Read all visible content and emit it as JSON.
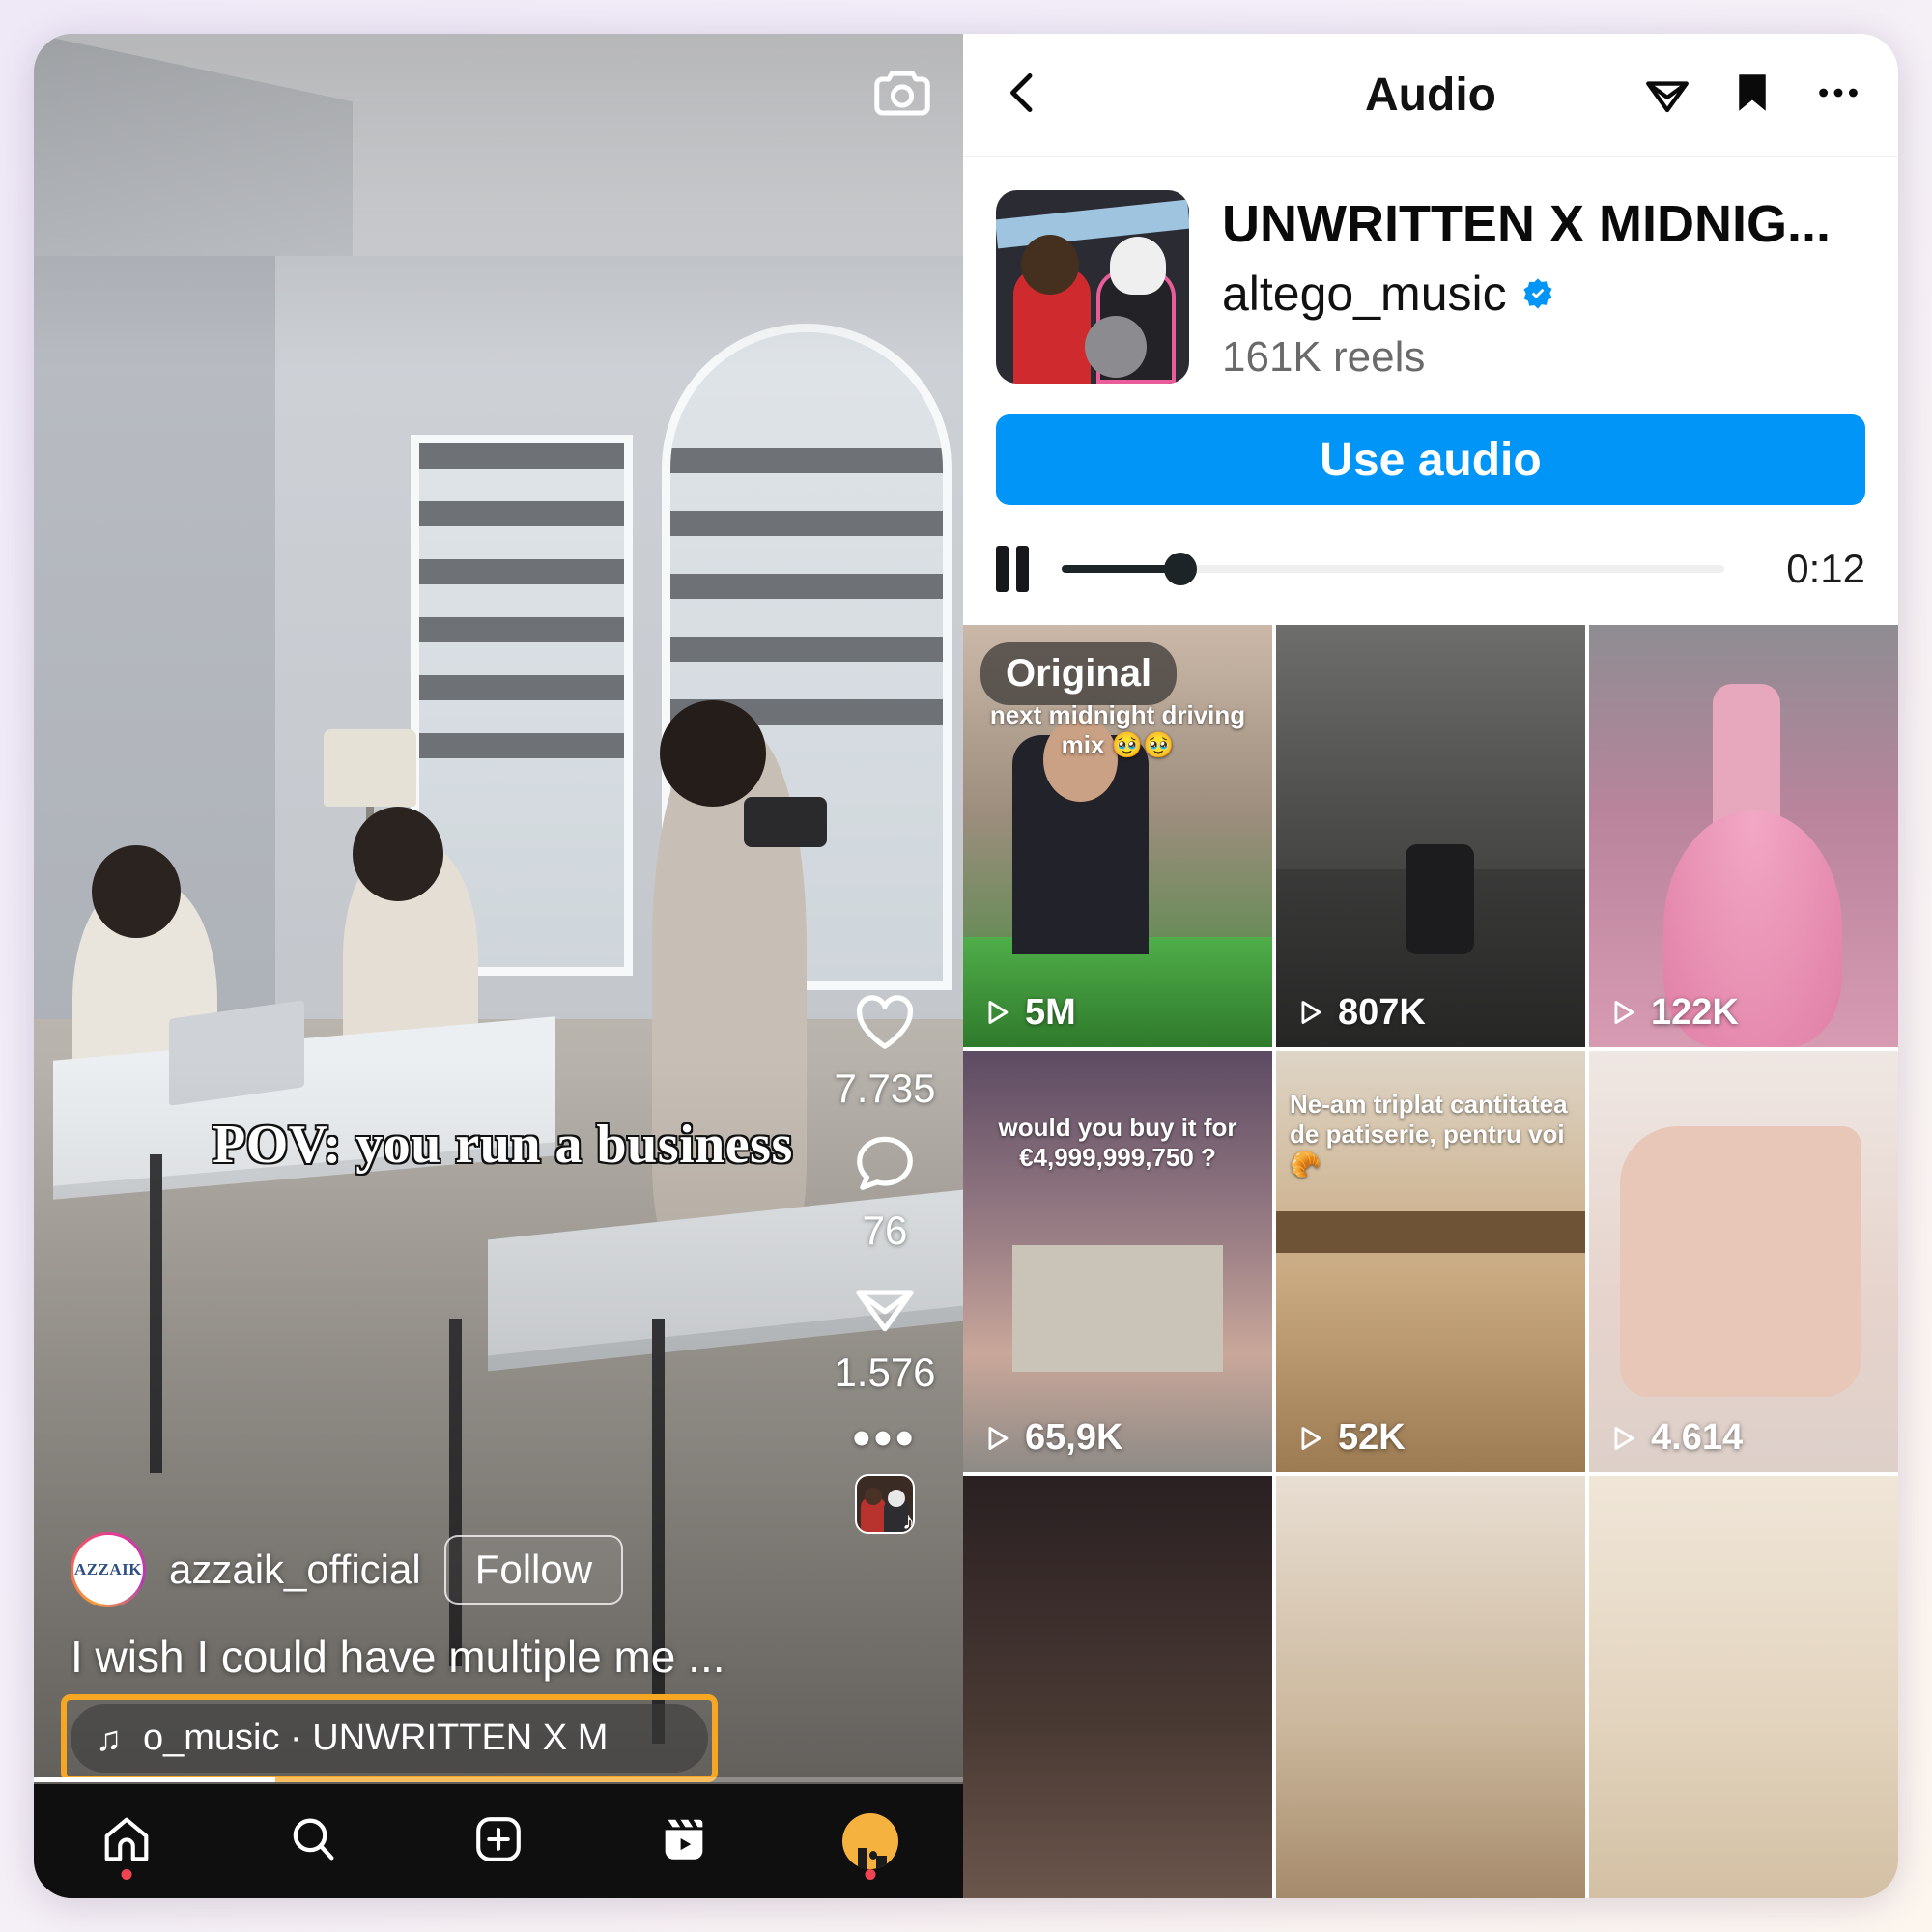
{
  "reel": {
    "camera_icon": "camera-icon",
    "overlay_caption": "POV:  you run a business",
    "username": "azzaik_official",
    "avatar_label": "AZZAIK",
    "follow_label": "Follow",
    "caption": "I wish I could have multiple me ...",
    "audio_chip_text": "o_music · UNWRITTEN X M",
    "music_note": "♫",
    "actions": {
      "like_icon": "heart-icon",
      "like_count": "7.735",
      "comment_icon": "comment-icon",
      "comment_count": "76",
      "share_icon": "share-icon",
      "share_count": "1.576",
      "more_icon": "ellipsis-icon",
      "more_label": "•••"
    },
    "highlight_color": "#f5a623"
  },
  "tabbar": {
    "items": [
      {
        "name": "home",
        "icon": "home-icon",
        "badge": true
      },
      {
        "name": "search",
        "icon": "search-icon",
        "badge": false
      },
      {
        "name": "create",
        "icon": "plus-square-icon",
        "badge": false
      },
      {
        "name": "reels",
        "icon": "reels-icon",
        "badge": false
      },
      {
        "name": "profile",
        "icon": "avatar-icon",
        "badge": true
      }
    ]
  },
  "audio_page": {
    "back_icon": "back-chevron-icon",
    "title": "Audio",
    "share_icon": "share-icon",
    "save_icon": "bookmark-filled-icon",
    "more_icon": "ellipsis-icon",
    "song_title": "UNWRITTEN X MIDNIG...",
    "artist": "altego_music",
    "verified_icon": "verified-badge-icon",
    "verified_color": "#0095f6",
    "reels_count": "161K reels",
    "use_audio_label": "Use audio",
    "use_audio_color": "#0095f6",
    "player": {
      "pause_icon": "pause-icon",
      "elapsed": "0:12",
      "progress_percent": 18
    },
    "grid": [
      {
        "views": "5M",
        "badge": "Original",
        "overlay": "next midnight driving mix 🥹🥹",
        "art": "art-a"
      },
      {
        "views": "807K",
        "badge": "",
        "overlay": "",
        "art": "art-b"
      },
      {
        "views": "122K",
        "badge": "",
        "overlay": "",
        "art": "art-c"
      },
      {
        "views": "65,9K",
        "badge": "",
        "overlay": "would you buy it for €4,999,999,750 ?",
        "art": "art-d"
      },
      {
        "views": "52K",
        "badge": "",
        "overlay": "Ne-am triplat cantitatea de patiserie, pentru voi 🥐",
        "art": "art-e"
      },
      {
        "views": "4.614",
        "badge": "",
        "overlay": "",
        "art": "art-f"
      },
      {
        "views": "",
        "badge": "",
        "overlay": "",
        "art": "art-g"
      },
      {
        "views": "",
        "badge": "",
        "overlay": "",
        "art": "art-h"
      },
      {
        "views": "",
        "badge": "",
        "overlay": "",
        "art": "art-i"
      }
    ]
  }
}
